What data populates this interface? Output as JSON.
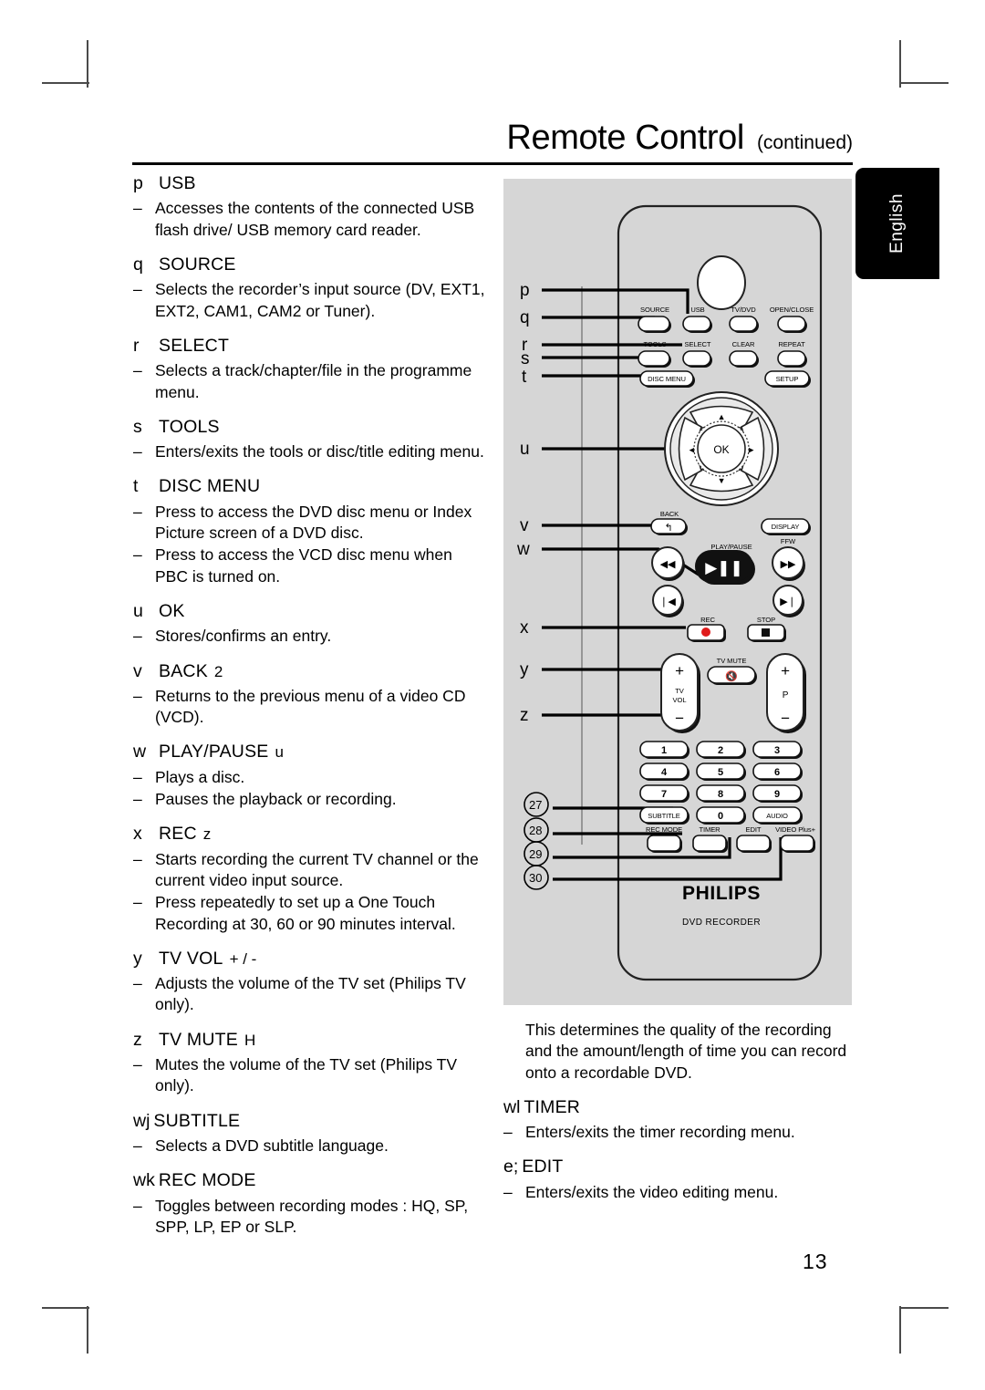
{
  "header": {
    "title": "Remote Control",
    "subtitle": "(continued)"
  },
  "side_tab": {
    "label": "English"
  },
  "page_number": "13",
  "left_column": [
    {
      "key": "p",
      "name": "USB",
      "symbol": "",
      "bullets": [
        "Accesses the contents of the connected USB flash drive/ USB memory card reader."
      ]
    },
    {
      "key": "q",
      "name": "SOURCE",
      "symbol": "",
      "bullets": [
        "Selects the recorder’s input source (DV, EXT1, EXT2, CAM1, CAM2 or Tuner)."
      ]
    },
    {
      "key": "r",
      "name": "SELECT",
      "symbol": "",
      "bullets": [
        "Selects a track/chapter/file in the programme menu."
      ]
    },
    {
      "key": "s",
      "name": "TOOLS",
      "symbol": "",
      "bullets": [
        "Enters/exits the tools or disc/title editing menu."
      ]
    },
    {
      "key": "t",
      "name": "DISC MENU",
      "symbol": "",
      "bullets": [
        "Press to access the DVD disc menu or Index Picture screen of a DVD disc.",
        "Press to access the VCD disc menu when PBC is turned on."
      ]
    },
    {
      "key": "u",
      "name": "OK",
      "symbol": "",
      "bullets": [
        "Stores/confirms an entry."
      ]
    },
    {
      "key": "v",
      "name": "BACK",
      "symbol": "2",
      "bullets": [
        "Returns to the previous menu of a video CD (VCD)."
      ]
    },
    {
      "key": "w",
      "name": "PLAY/PAUSE",
      "symbol": "u",
      "bullets": [
        "Plays a disc.",
        "Pauses the playback or recording."
      ]
    },
    {
      "key": "x",
      "name": "REC",
      "symbol": "z",
      "bullets": [
        "Starts recording the current TV channel or the current video input source.",
        "Press repeatedly to set up a One Touch Recording at 30, 60 or 90 minutes interval."
      ]
    },
    {
      "key": "y",
      "name": "TV VOL",
      "symbol": "+ / -",
      "bullets": [
        "Adjusts the volume of the TV set (Philips TV only)."
      ]
    },
    {
      "key": "z",
      "name": "TV MUTE",
      "symbol": "H",
      "bullets": [
        "Mutes the volume of the TV set (Philips TV only)."
      ]
    },
    {
      "key": "wj",
      "name": "SUBTITLE",
      "symbol": "",
      "bullets": [
        "Selects a DVD subtitle language."
      ]
    },
    {
      "key": "wk",
      "name": "REC MODE",
      "symbol": "",
      "bullets": [
        "Toggles between recording modes : HQ, SP, SPP, LP, EP or SLP."
      ]
    }
  ],
  "right_column": {
    "intro_paragraph": "This determines the quality of the recording and the amount/length of time you can record onto a recordable DVD.",
    "entries": [
      {
        "key": "wl",
        "name": "TIMER",
        "symbol": "",
        "bullets": [
          "Enters/exits the timer recording menu."
        ]
      },
      {
        "key": "e;",
        "name": "EDIT",
        "symbol": "",
        "bullets": [
          "Enters/exits the video editing menu."
        ]
      }
    ]
  },
  "diagram": {
    "brand": "PHILIPS",
    "brand_sub": "DVD RECORDER",
    "callout_letters": [
      "p",
      "q",
      "r",
      "s",
      "t",
      "u",
      "v",
      "w",
      "x",
      "y",
      "z"
    ],
    "callout_numbers": [
      "27",
      "28",
      "29",
      "30"
    ],
    "buttons_row1": [
      "SOURCE",
      "USB",
      "TV/DVD",
      "OPEN/CLOSE"
    ],
    "buttons_row2": [
      "TOOLS",
      "SELECT",
      "CLEAR",
      "REPEAT"
    ],
    "buttons_row3": [
      "DISC MENU",
      "SETUP"
    ],
    "nav_center": "OK",
    "nav_arrows": [
      "▲",
      "◀",
      "▶",
      "▼"
    ],
    "back_label": "BACK",
    "display_label": "DISPLAY",
    "transport_labels": [
      "PLAY/PAUSE",
      "FFW"
    ],
    "rec_label": "REC",
    "stop_label": "STOP",
    "tv_vol_label": "TV VOL",
    "tv_mute_label": "TV MUTE",
    "p_label": "P",
    "plus": "+",
    "minus": "−",
    "numpad": [
      "1",
      "2",
      "3",
      "4",
      "5",
      "6",
      "7",
      "8",
      "9",
      "0"
    ],
    "subtitle_label": "SUBTITLE",
    "audio_label": "AUDIO",
    "recmode_label": "REC MODE",
    "timer_label": "TIMER",
    "edit_label": "EDIT",
    "videoplus_label": "VIDEO Plus+",
    "panel_bg": "#d6d6d6"
  }
}
